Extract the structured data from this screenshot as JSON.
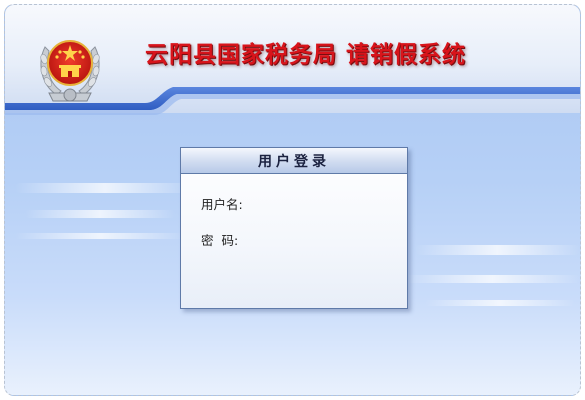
{
  "header": {
    "title": "云阳县国家税务局  请销假系统"
  },
  "login": {
    "title": "用户登录",
    "username_label": "用户名:",
    "username_value": "",
    "password_label": "密  码:",
    "password_value": ""
  },
  "colors": {
    "title_red": "#d8141b",
    "header_band_blue": "#3e6fd2",
    "background_blue": "#a9c6f2"
  }
}
